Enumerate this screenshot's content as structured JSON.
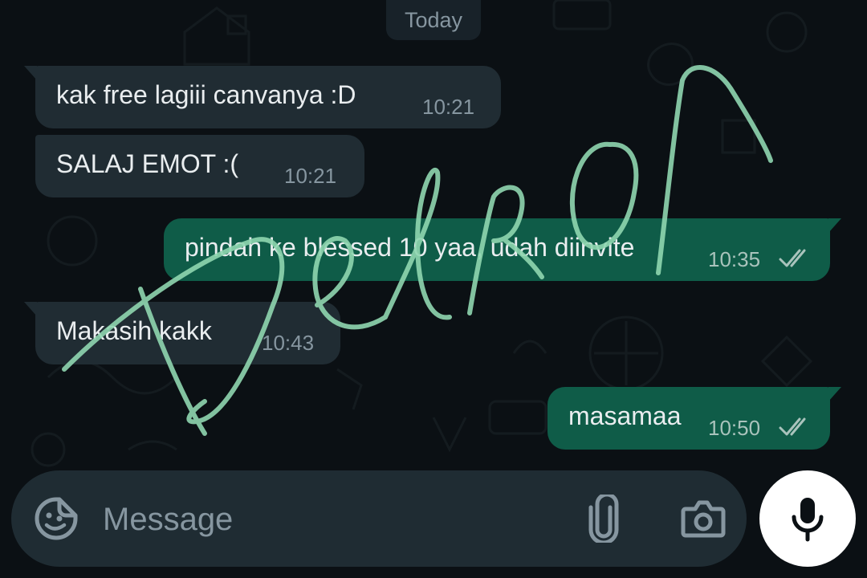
{
  "chat": {
    "date_label": "Today",
    "messages": [
      {
        "direction": "incoming",
        "text": "kak free lagiii canvanya :D",
        "time": "10:21"
      },
      {
        "direction": "incoming",
        "text": "SALAJ EMOT :(",
        "time": "10:21"
      },
      {
        "direction": "outgoing",
        "text": "pindah ke blessed 10 yaa, udah diinvite",
        "time": "10:35",
        "status": "read-double-check"
      },
      {
        "direction": "incoming",
        "text": "Makasih kakk",
        "time": "10:43"
      },
      {
        "direction": "outgoing",
        "text": "masamaa",
        "time": "10:50",
        "status": "read-double-check"
      }
    ]
  },
  "composer": {
    "placeholder": "Message",
    "value": "",
    "icons": [
      "emoji-sticker-icon",
      "paperclip-icon",
      "camera-icon",
      "microphone-icon"
    ]
  },
  "watermark": {
    "text": "Delron",
    "color": "#8fd6b0"
  },
  "colors": {
    "background": "#0b1014",
    "incoming_bubble": "#202c33",
    "outgoing_bubble": "#0f5c48",
    "text": "#e9edef",
    "meta": "#8696a0",
    "input_bar": "#1f2c33",
    "mic_button": "#ffffff"
  }
}
